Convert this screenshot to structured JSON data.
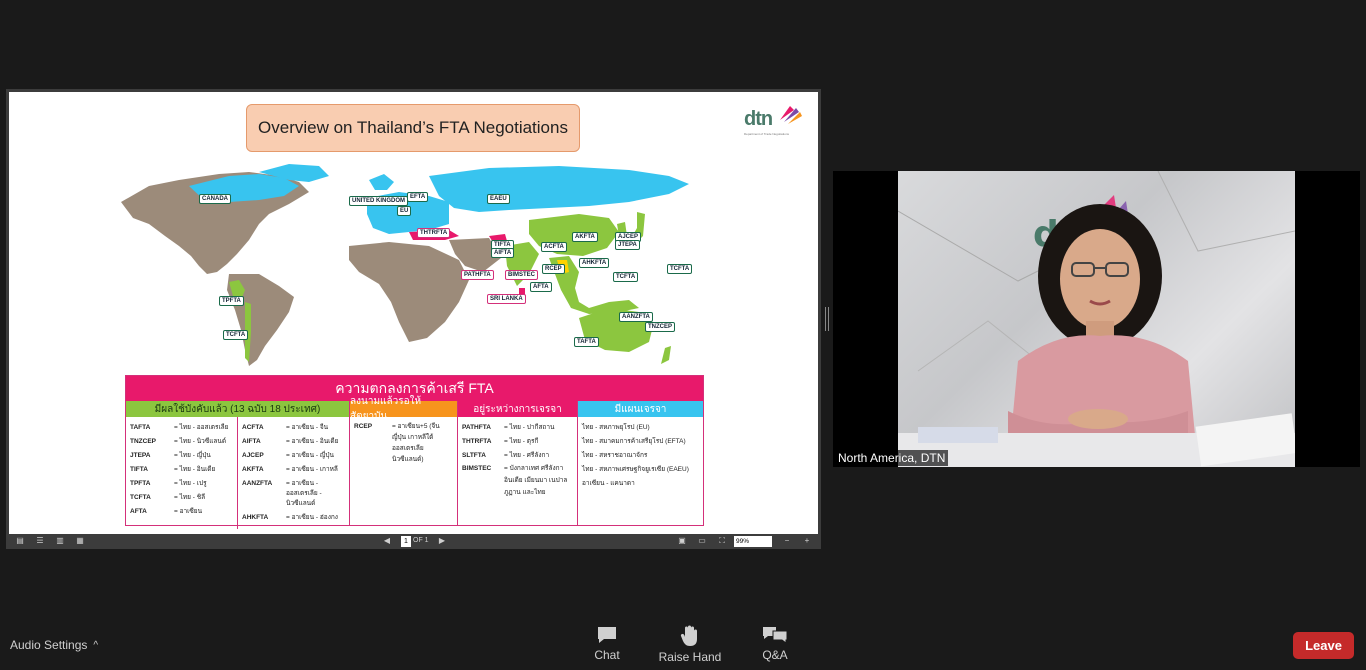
{
  "slide": {
    "title": "Overview on Thailand’s FTA Negotiations",
    "logo_text": "dtn",
    "logo_sub": "Department of Trade Negotiations",
    "map_labels": [
      "CANADA",
      "UNITED KINGDOM",
      "EU",
      "EFTA",
      "EAEU",
      "THTRFTA",
      "TIFTA",
      "AIFTA",
      "ACFTA",
      "AKFTA",
      "AJCEP",
      "JTEPA",
      "AHKFTA",
      "PATHFTA",
      "BIMSTEC",
      "RCEP",
      "AFTA",
      "TCFTA",
      "TCFTA",
      "SRI LANKA",
      "TPFTA",
      "TCFTA",
      "AANZFTA",
      "TNZCEP",
      "TAFTA"
    ],
    "table": {
      "header": "ความตกลงการค้าเสรี FTA",
      "col1": {
        "title": "มีผลใช้บังคับแล้ว (13 ฉบับ 18 ประเทศ)",
        "left": [
          {
            "k": "TAFTA",
            "v": "= ไทย - ออสเตรเลีย"
          },
          {
            "k": "TNZCEP",
            "v": "= ไทย - นิวซีแลนด์"
          },
          {
            "k": "JTEPA",
            "v": "= ไทย - ญี่ปุ่น"
          },
          {
            "k": "TIFTA",
            "v": "= ไทย - อินเดีย"
          },
          {
            "k": "TPFTA",
            "v": "= ไทย - เปรู"
          },
          {
            "k": "TCFTA",
            "v": "= ไทย - ชิลี"
          },
          {
            "k": "AFTA",
            "v": "= อาเซียน"
          }
        ],
        "right": [
          {
            "k": "ACFTA",
            "v": "= อาเซียน - จีน"
          },
          {
            "k": "AIFTA",
            "v": "= อาเซียน - อินเดีย"
          },
          {
            "k": "AJCEP",
            "v": "= อาเซียน - ญี่ปุ่น"
          },
          {
            "k": "AKFTA",
            "v": "= อาเซียน - เกาหลี"
          },
          {
            "k": "AANZFTA",
            "v": "= อาเซียน - ออสเตรเลีย - นิวซีแลนด์"
          },
          {
            "k": "AHKFTA",
            "v": "= อาเซียน - ฮ่องกง"
          }
        ]
      },
      "col2": {
        "title": "ลงนามแล้วรอให้สัตยาบัน",
        "rows": [
          {
            "k": "RCEP",
            "v": "= อาเซียน+5 (จีน ญี่ปุ่น เกาหลีใต้ ออสเตรเลีย นิวซีแลนด์)"
          }
        ]
      },
      "col3": {
        "title": "อยู่ระหว่างการเจรจา",
        "rows": [
          {
            "k": "PATHFTA",
            "v": "= ไทย - ปากีสถาน"
          },
          {
            "k": "THTRFTA",
            "v": "= ไทย - ตุรกี"
          },
          {
            "k": "SLTFTA",
            "v": "= ไทย - ศรีลังกา"
          },
          {
            "k": "BIMSTEC",
            "v": "= บังกลาเทศ ศรีลังกา อินเดีย เมียนมา เนปาล ภูฏาน และไทย"
          }
        ]
      },
      "col4": {
        "title": "มีแผนเจรจา",
        "rows": [
          "ไทย - สหภาพยุโรป (EU)",
          "ไทย - สมาคมการค้าเสรียุโรป (EFTA)",
          "ไทย - สหราชอาณาจักร",
          "ไทย - สหภาพเศรษฐกิจยูเรเซีย (EAEU)",
          "อาเซียน - แคนาดา"
        ]
      }
    }
  },
  "viewer": {
    "page": "1",
    "of": "OF 1",
    "zoom": "99%"
  },
  "video": {
    "name": "North America, DTN"
  },
  "controls": {
    "audio_settings": "Audio Settings",
    "chat": "Chat",
    "raise_hand": "Raise Hand",
    "qa": "Q&A",
    "leave": "Leave"
  },
  "colors": {
    "blue": "#38c4ef",
    "green": "#8cc63f",
    "pink": "#e8196b",
    "orange": "#f7941d",
    "land": "#9c8b7a",
    "leave": "#c52a2a"
  }
}
